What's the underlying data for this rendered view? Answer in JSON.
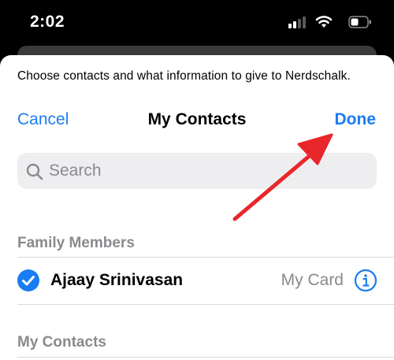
{
  "status_bar": {
    "time": "2:02",
    "icons": [
      "cellular-signal-icon",
      "wifi-icon",
      "battery-icon"
    ]
  },
  "sheet": {
    "prompt": "Choose contacts and what information to give to Nerdschalk.",
    "nav": {
      "cancel_label": "Cancel",
      "title": "My Contacts",
      "done_label": "Done"
    },
    "search": {
      "placeholder": "Search",
      "value": ""
    },
    "sections": [
      {
        "header": "Family Members",
        "rows": [
          {
            "name": "Ajaay Srinivasan",
            "detail": "My Card",
            "selected": true,
            "icons": [
              "checkmark-icon",
              "info-icon"
            ]
          }
        ]
      },
      {
        "header": "My Contacts",
        "rows": []
      }
    ]
  },
  "annotation": {
    "type": "arrow",
    "color": "#e8272b",
    "points_to": "done-button"
  },
  "colors": {
    "accent": "#1a7cf3",
    "secondary_text": "#8a8a8e",
    "search_bg": "#eeeef0"
  }
}
